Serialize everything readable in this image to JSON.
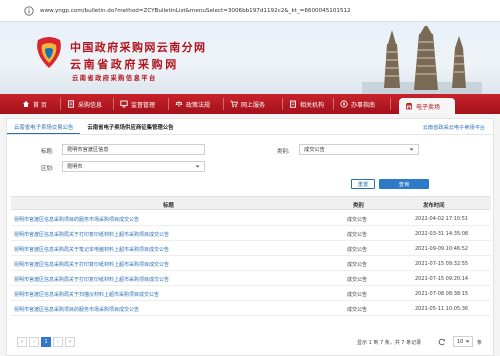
{
  "browser": {
    "url": "www.yngp.com/bulletin.do?method=ZCYBulletinList&menuSelect=3006bb197d1192c2&_kt_=6600045101512"
  },
  "banner": {
    "line1": "中国政府采购网云南分网",
    "line2": "云南省政府采购网",
    "line3": "云南省政府采购信息平台"
  },
  "nav": {
    "items": [
      {
        "label": "首 页",
        "icon": "home-icon"
      },
      {
        "label": "采购信息",
        "icon": "document-icon"
      },
      {
        "label": "监督管理",
        "icon": "monitor-icon"
      },
      {
        "label": "政策法规",
        "icon": "scale-icon"
      },
      {
        "label": "网上服务",
        "icon": "cart-icon"
      },
      {
        "label": "相关机构",
        "icon": "building-icon"
      },
      {
        "label": "办事指南",
        "icon": "guide-icon"
      },
      {
        "label": "电子卖场",
        "icon": "store-icon"
      }
    ]
  },
  "tabs": {
    "tab1": "云南省电子卖场交易公告",
    "tab2": "云南省电子卖场供应商征集管理公告",
    "link": "云南省政采云电子卖场平台"
  },
  "filters": {
    "title_label": "标题:",
    "title_value": "昆明市官渡区信息",
    "category_label": "类别:",
    "category_value": "成交公告",
    "region_label": "区划:",
    "region_value": "昆明市",
    "reset_label": "重置",
    "query_label": "查询"
  },
  "table": {
    "headers": [
      "标题",
      "类别",
      "发布时间"
    ],
    "rows": [
      {
        "title": "昆明市官渡区信息采购项目的服务市场采购项目成交公告",
        "type": "成交公告",
        "time": "2022-04-02 17:10:51"
      },
      {
        "title": "昆明市官渡区信息采购局关于打印复印纸材料上超市采购项目成交公告",
        "type": "成交公告",
        "time": "2022-03-31 14:35:08"
      },
      {
        "title": "昆明市官渡区信息采购局关于笔记本电脑材料上超市采购项目成交公告",
        "type": "成交公告",
        "time": "2021-09-09 10:46:52"
      },
      {
        "title": "昆明市官渡区信息采购局关于打印复印纸材料上超市采购项目成交公告",
        "type": "成交公告",
        "time": "2021-07-15 09:32:55"
      },
      {
        "title": "昆明市官渡区信息采购局关于打印复印纸材料上超市采购项目成交公告",
        "type": "成交公告",
        "time": "2021-07-15 09:20:14"
      },
      {
        "title": "昆明市官渡区信息采购局关于扫描仪材料上超市采购项目成交公告",
        "type": "成交公告",
        "time": "2021-07-08 08:38:15"
      },
      {
        "title": "昆明市官渡区信息采购项目的服务市场采购项目成交公告",
        "type": "成交公告",
        "time": "2021-05-11 10:05:36"
      }
    ]
  },
  "pagination": {
    "first": "«",
    "prev": "‹",
    "current": "1",
    "next": "›",
    "last": "»",
    "info": "显示 1 到 7 条，共 7 条记录",
    "page_size": "10",
    "unit": "条"
  },
  "colors": {
    "brand_red": "#b3141e",
    "link_blue": "#2a6fb6",
    "button_blue": "#2f7ac8"
  }
}
